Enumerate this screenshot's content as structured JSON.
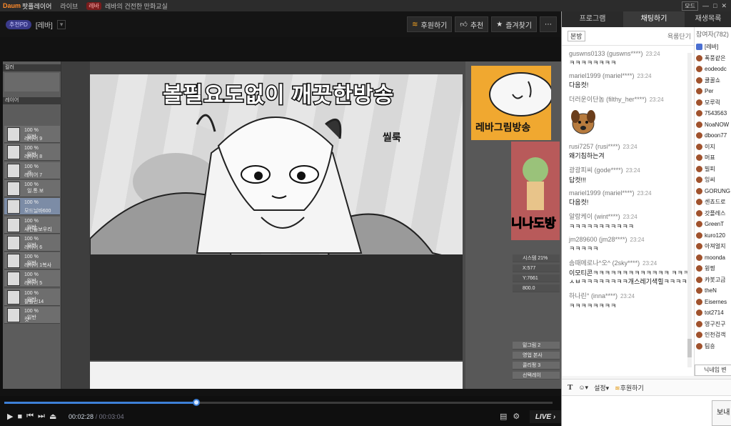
{
  "titlebar": {
    "logo": "Daum",
    "app_name": "팟플레이어",
    "live_menu": "라이브",
    "badge": "레바",
    "broadcast_title": "레바의 건전한 만화교실",
    "mode_btn": "모드",
    "win_minimize": "—",
    "win_maximize": "□",
    "win_close": "✕"
  },
  "player": {
    "pd_badge": "추천PD",
    "bj_name": "[레바]",
    "actions": [
      {
        "label": "후원하기",
        "icon": "coin-stack-icon"
      },
      {
        "label": "추천",
        "icon": "thumbs-up-icon"
      },
      {
        "label": "즐겨찾기",
        "icon": "star-icon"
      }
    ],
    "more": "⋯",
    "video": {
      "caption": "볼필요도없이 깨끗한방송",
      "sfx": "씰룩",
      "thumb_title": "레바그림방송",
      "mini_text": "니나도방",
      "left_panel_header": "레이어",
      "layers": [
        {
          "pct": "100 %",
          "mode": "일반",
          "name": "레이어 9"
        },
        {
          "pct": "100 %",
          "mode": "일반",
          "name": "레이어 8"
        },
        {
          "pct": "100 %",
          "mode": "가",
          "name": "레이어 7"
        },
        {
          "pct": "100 %",
          "mode": "일.통.보",
          "name": ""
        },
        {
          "pct": "100 %",
          "mode": "",
          "name": "모드닐바600"
        },
        {
          "pct": "100 %",
          "mode": "일반",
          "name": "새건들보우리"
        },
        {
          "pct": "100 %",
          "mode": "일반",
          "name": "레이어 6"
        },
        {
          "pct": "100 %",
          "mode": "일반",
          "name": "레이어 1복사"
        },
        {
          "pct": "100 %",
          "mode": "일반",
          "name": "레이어 5"
        },
        {
          "pct": "100 %",
          "mode": "일반",
          "name": "팔플선14"
        },
        {
          "pct": "100 %",
          "mode": "일반",
          "name": "컷"
        }
      ],
      "right_rows": [
        "밑그림 2",
        "영업 본사",
        "콜리펑 3",
        "선택레이"
      ],
      "status_rows": [
        "시스템 21%",
        "X:577",
        "Y:7661",
        "800.0"
      ]
    }
  },
  "controls": {
    "play": "▶",
    "stop": "■",
    "prev": "⏮",
    "next": "⏭",
    "eject": "⏏",
    "current": "00:02:28",
    "separator": "/",
    "total": "00:03:04",
    "progress": 0.35,
    "volume": 0.1,
    "live_label": "LIVE"
  },
  "sidebar": {
    "tabs": [
      "프로그램",
      "채팅하기",
      "재생목록"
    ],
    "chat_header_left": "본방",
    "chat_header_right": "욕룸단기",
    "messages": [
      {
        "user": "guswns0133 (guswns****)",
        "time": "23:24",
        "text": "ㅋㅋㅋㅋㅋㅋㅋㅋ"
      },
      {
        "user": "mariel1999 (mariel****)",
        "time": "23:24",
        "text": "다음컷!"
      },
      {
        "user": "더러운이단놈 (filthy_her****)",
        "time": "23:24",
        "text": ""
      },
      {
        "user": "rusi7257 (rusi****)",
        "time": "23:24",
        "text": "왜기침하는겨"
      },
      {
        "user": "광광피씨 (gode****)",
        "time": "23:24",
        "text": "답컷!!!"
      },
      {
        "user": "mariel1999 (mariel****)",
        "time": "23:24",
        "text": "다음컷!"
      },
      {
        "user": "알랑케이 (wint****)",
        "time": "23:24",
        "text": "ㅋㅋㅋㅋㅋㅋㅋㅋㅋㅋㅋ"
      },
      {
        "user": "jm289600 (jm28****)",
        "time": "23:24",
        "text": "ㅋㅋㅋㅋㅋ"
      },
      {
        "user": "솜때메로나^오^ (2sky****)",
        "time": "23:24",
        "text": "이모티콘ㅋㅋㅋㅋㅋㅋㅋㅋㅋㅋㅋㅋㅋ ㅋㅋㅋㅅㅂㅋㅋㅋㅋㅋㅋㅋㅋ개스레기색힐ㅋㅋㅋㅋ"
      },
      {
        "user": "하나린° (inna****)",
        "time": "23:24",
        "text": "ㅋㅋㅋㅋㅋㅋㅋㅋ"
      }
    ],
    "users_header": "참여자(782)",
    "users": [
      {
        "name": "[레바]",
        "bj": true
      },
      {
        "name": "폭풍같은",
        "bj": false
      },
      {
        "name": "eodeodc",
        "bj": false
      },
      {
        "name": "쿨꿀쇼",
        "bj": false
      },
      {
        "name": "Per",
        "bj": false
      },
      {
        "name": "모루릭",
        "bj": false
      },
      {
        "name": "7543563",
        "bj": false
      },
      {
        "name": "NoaNOW",
        "bj": false
      },
      {
        "name": "dboon77",
        "bj": false
      },
      {
        "name": "이지",
        "bj": false
      },
      {
        "name": "머표",
        "bj": false
      },
      {
        "name": "빌피",
        "bj": false
      },
      {
        "name": "잉씨",
        "bj": false
      },
      {
        "name": "GORUNG",
        "bj": false
      },
      {
        "name": "센쵸드로",
        "bj": false
      },
      {
        "name": "갓플레스",
        "bj": false
      },
      {
        "name": "GreenT",
        "bj": false
      },
      {
        "name": "kuro120",
        "bj": false
      },
      {
        "name": "아져얼지",
        "bj": false
      },
      {
        "name": "moonda",
        "bj": false
      },
      {
        "name": "윙찡",
        "bj": false
      },
      {
        "name": "캬봇고금",
        "bj": false
      },
      {
        "name": "theN",
        "bj": false
      },
      {
        "name": "Eisernes",
        "bj": false
      },
      {
        "name": "tot2714",
        "bj": false
      },
      {
        "name": "영구진구",
        "bj": false
      },
      {
        "name": "인천검객",
        "bj": false
      },
      {
        "name": "팀숑",
        "bj": false
      }
    ],
    "nickname_btn": "닉네임 변",
    "toolbar": {
      "bold": "T",
      "emoji": "☺",
      "settings": "설정",
      "donate": "후원하기"
    },
    "send_btn": "보내"
  }
}
